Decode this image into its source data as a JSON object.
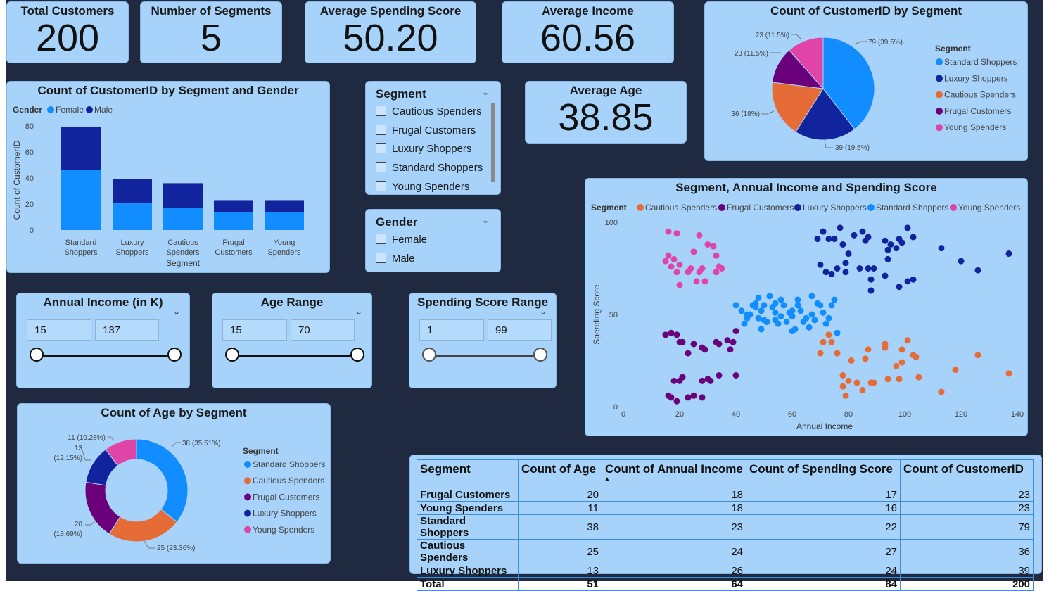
{
  "kpis": {
    "total_customers": {
      "title": "Total Customers",
      "value": "200"
    },
    "num_segments": {
      "title": "Number of Segments",
      "value": "5"
    },
    "avg_spending": {
      "title": "Average Spending Score",
      "value": "50.20"
    },
    "avg_income": {
      "title": "Average Income",
      "value": "60.56"
    },
    "avg_age": {
      "title": "Average Age",
      "value": "38.85"
    }
  },
  "colors": {
    "standard": "#118dff",
    "luxury": "#12239e",
    "cautious": "#e66c37",
    "frugal": "#6b007b",
    "young": "#e044a7",
    "female": "#118dff",
    "male": "#12239e"
  },
  "bar_chart": {
    "title": "Count of CustomerID by Segment and Gender",
    "legend_title": "Gender",
    "legend": [
      "Female",
      "Male"
    ],
    "ylabel": "Count of CustomerID",
    "xlabel": "Segment",
    "yticks": [
      "0",
      "20",
      "40",
      "60",
      "80"
    ],
    "categories": [
      [
        "Standard",
        "Shoppers"
      ],
      [
        "Luxury",
        "Shoppers"
      ],
      [
        "Cautious",
        "Spenders"
      ],
      [
        "Frugal",
        "Customers"
      ],
      [
        "Young",
        "Spenders"
      ]
    ]
  },
  "pie_chart": {
    "title": "Count of CustomerID by Segment",
    "legend_title": "Segment",
    "legend": [
      "Standard Shoppers",
      "Luxury Shoppers",
      "Cautious Spenders",
      "Frugal Customers",
      "Young Spenders"
    ],
    "labels": [
      "79 (39.5%)",
      "39 (19.5%)",
      "36 (18%)",
      "23 (11.5%)",
      "23 (11.5%)"
    ]
  },
  "segment_slicer": {
    "title": "Segment",
    "items": [
      "Cautious Spenders",
      "Frugal Customers",
      "Luxury Shoppers",
      "Standard Shoppers",
      "Young Spenders"
    ]
  },
  "gender_slicer": {
    "title": "Gender",
    "items": [
      "Female",
      "Male"
    ]
  },
  "income_range": {
    "title": "Annual Income (in K)",
    "min": "15",
    "max": "137"
  },
  "age_range": {
    "title": "Age Range",
    "min": "15",
    "max": "70"
  },
  "spending_range": {
    "title": "Spending Score Range",
    "min": "1",
    "max": "99"
  },
  "scatter": {
    "title": "Segment, Annual Income and Spending Score",
    "legend_title": "Segment",
    "legend": [
      "Cautious Spenders",
      "Frugal Customers",
      "Luxury Shoppers",
      "Standard Shoppers",
      "Young Spenders"
    ],
    "xlabel": "Annual Income",
    "ylabel": "Spending Score",
    "xticks": [
      "0",
      "20",
      "40",
      "60",
      "80",
      "100",
      "120",
      "140"
    ],
    "yticks": [
      "0",
      "50",
      "100"
    ]
  },
  "donut": {
    "title": "Count of Age by Segment",
    "legend_title": "Segment",
    "legend": [
      "Standard Shoppers",
      "Cautious Spenders",
      "Frugal Customers",
      "Luxury Shoppers",
      "Young Spenders"
    ],
    "labels": [
      "38 (35.51%)",
      "25 (23.36%)",
      "20",
      "(18.69%)",
      "13",
      "(12.15%)",
      "11 (10.28%)"
    ]
  },
  "table": {
    "headers": [
      "Segment",
      "Count of Age",
      "Count of Annual Income",
      "Count of Spending Score",
      "Count of CustomerID"
    ],
    "rows": [
      [
        "Frugal Customers",
        "20",
        "18",
        "17",
        "23"
      ],
      [
        "Young Spenders",
        "11",
        "18",
        "16",
        "23"
      ],
      [
        "Standard Shoppers",
        "38",
        "23",
        "22",
        "79"
      ],
      [
        "Cautious Spenders",
        "25",
        "24",
        "27",
        "36"
      ],
      [
        "Luxury Shoppers",
        "13",
        "26",
        "24",
        "39"
      ]
    ],
    "total": [
      "Total",
      "51",
      "64",
      "84",
      "200"
    ]
  },
  "chart_data": [
    {
      "type": "bar",
      "title": "Count of CustomerID by Segment and Gender",
      "categories": [
        "Standard Shoppers",
        "Luxury Shoppers",
        "Cautious Spenders",
        "Frugal Customers",
        "Young Spenders"
      ],
      "series": [
        {
          "name": "Female",
          "values": [
            46,
            21,
            17,
            14,
            14
          ]
        },
        {
          "name": "Male",
          "values": [
            33,
            18,
            19,
            9,
            9
          ]
        }
      ],
      "stacked": true,
      "xlabel": "Segment",
      "ylabel": "Count of CustomerID",
      "ylim": [
        0,
        80
      ]
    },
    {
      "type": "pie",
      "title": "Count of CustomerID by Segment",
      "categories": [
        "Standard Shoppers",
        "Luxury Shoppers",
        "Cautious Spenders",
        "Frugal Customers",
        "Young Spenders"
      ],
      "values": [
        79,
        39,
        36,
        23,
        23
      ]
    },
    {
      "type": "pie",
      "title": "Count of Age by Segment",
      "donut": true,
      "categories": [
        "Standard Shoppers",
        "Cautious Spenders",
        "Frugal Customers",
        "Luxury Shoppers",
        "Young Spenders"
      ],
      "values": [
        38,
        25,
        20,
        13,
        11
      ]
    },
    {
      "type": "scatter",
      "title": "Segment, Annual Income and Spending Score",
      "xlabel": "Annual Income",
      "ylabel": "Spending Score",
      "xlim": [
        0,
        140
      ],
      "ylim": [
        0,
        100
      ],
      "series": [
        {
          "name": "Young Spenders",
          "points": [
            [
              16,
              95
            ],
            [
              19,
              94
            ],
            [
              16,
              82
            ],
            [
              15,
              79
            ],
            [
              17,
              76
            ],
            [
              18,
              80
            ],
            [
              20,
              77
            ],
            [
              19,
              73
            ],
            [
              23,
              73
            ],
            [
              24,
              75
            ],
            [
              26,
              68
            ],
            [
              27,
              73
            ],
            [
              28,
              75
            ],
            [
              25,
              84
            ],
            [
              27,
              93
            ],
            [
              30,
              88
            ],
            [
              32,
              87
            ],
            [
              33,
              82
            ],
            [
              33,
              73
            ],
            [
              34,
              76
            ],
            [
              35,
              75
            ],
            [
              29,
              68
            ],
            [
              20,
              66
            ]
          ]
        },
        {
          "name": "Frugal Customers",
          "points": [
            [
              15,
              39
            ],
            [
              17,
              40
            ],
            [
              19,
              39
            ],
            [
              20,
              35
            ],
            [
              21,
              35
            ],
            [
              23,
              29
            ],
            [
              25,
              34
            ],
            [
              28,
              32
            ],
            [
              28,
              14
            ],
            [
              29,
              31
            ],
            [
              33,
              35
            ],
            [
              34,
              34
            ],
            [
              37,
              36
            ],
            [
              38,
              31
            ],
            [
              39,
              35
            ],
            [
              40,
              41
            ],
            [
              16,
              6
            ],
            [
              17,
              5
            ],
            [
              18,
              14
            ],
            [
              19,
              3
            ],
            [
              20,
              14
            ],
            [
              21,
              16
            ],
            [
              23,
              5
            ],
            [
              25,
              6
            ],
            [
              28,
              5
            ],
            [
              30,
              15
            ],
            [
              31,
              14
            ],
            [
              34,
              17
            ],
            [
              40,
              17
            ]
          ]
        },
        {
          "name": "Standard Shoppers",
          "points": [
            [
              40,
              55
            ],
            [
              42,
              52
            ],
            [
              43,
              45
            ],
            [
              44,
              48
            ],
            [
              45,
              50
            ],
            [
              46,
              55
            ],
            [
              47,
              56
            ],
            [
              48,
              48
            ],
            [
              48,
              59
            ],
            [
              49,
              42
            ],
            [
              50,
              47
            ],
            [
              50,
              55
            ],
            [
              51,
              46
            ],
            [
              52,
              60
            ],
            [
              53,
              54
            ],
            [
              54,
              47
            ],
            [
              54,
              51
            ],
            [
              54,
              56
            ],
            [
              55,
              45
            ],
            [
              56,
              49
            ],
            [
              57,
              55
            ],
            [
              58,
              46
            ],
            [
              59,
              51
            ],
            [
              60,
              52
            ],
            [
              60,
              49
            ],
            [
              61,
              42
            ],
            [
              62,
              55
            ],
            [
              62,
              58
            ],
            [
              63,
              52
            ],
            [
              64,
              46
            ],
            [
              65,
              48
            ],
            [
              66,
              43
            ],
            [
              67,
              50
            ],
            [
              68,
              47
            ],
            [
              69,
              56
            ],
            [
              70,
              55
            ],
            [
              71,
              51
            ],
            [
              72,
              45
            ],
            [
              73,
              48
            ],
            [
              74,
              55
            ],
            [
              75,
              58
            ],
            [
              76,
              40
            ],
            [
              67,
              60
            ],
            [
              60,
              41
            ],
            [
              56,
              58
            ],
            [
              44,
              50
            ],
            [
              47,
              54
            ],
            [
              49,
              52
            ]
          ]
        },
        {
          "name": "Cautious Spenders",
          "points": [
            [
              70,
              29
            ],
            [
              71,
              35
            ],
            [
              73,
              39
            ],
            [
              74,
              35
            ],
            [
              76,
              29
            ],
            [
              78,
              17
            ],
            [
              78,
              11
            ],
            [
              80,
              14
            ],
            [
              79,
              6
            ],
            [
              81,
              25
            ],
            [
              83,
              13
            ],
            [
              85,
              9
            ],
            [
              86,
              26
            ],
            [
              87,
              31
            ],
            [
              88,
              13
            ],
            [
              89,
              13
            ],
            [
              93,
              34
            ],
            [
              93,
              32
            ],
            [
              94,
              15
            ],
            [
              97,
              22
            ],
            [
              98,
              15
            ],
            [
              99,
              31
            ],
            [
              99,
              24
            ],
            [
              101,
              36
            ],
            [
              103,
              28
            ],
            [
              104,
              27
            ],
            [
              105,
              16
            ],
            [
              113,
              8
            ],
            [
              118,
              20
            ],
            [
              126,
              28
            ],
            [
              137,
              18
            ]
          ]
        },
        {
          "name": "Luxury Shoppers",
          "points": [
            [
              69,
              91
            ],
            [
              70,
              77
            ],
            [
              71,
              95
            ],
            [
              72,
              73
            ],
            [
              73,
              91
            ],
            [
              74,
              72
            ],
            [
              75,
              91
            ],
            [
              76,
              75
            ],
            [
              77,
              97
            ],
            [
              78,
              88
            ],
            [
              79,
              73
            ],
            [
              80,
              83
            ],
            [
              82,
              93
            ],
            [
              84,
              75
            ],
            [
              85,
              95
            ],
            [
              86,
              90
            ],
            [
              87,
              75
            ],
            [
              87,
              92
            ],
            [
              88,
              63
            ],
            [
              88,
              69
            ],
            [
              89,
              75
            ],
            [
              93,
              90
            ],
            [
              94,
              80
            ],
            [
              95,
              88
            ],
            [
              97,
              86
            ],
            [
              98,
              91
            ],
            [
              99,
              89
            ],
            [
              101,
              97
            ],
            [
              103,
              92
            ],
            [
              113,
              86
            ],
            [
              120,
              79
            ],
            [
              126,
              74
            ],
            [
              137,
              83
            ],
            [
              93,
              71
            ],
            [
              94,
              85
            ],
            [
              98,
              65
            ],
            [
              101,
              68
            ],
            [
              103,
              69
            ],
            [
              79,
              78
            ]
          ]
        }
      ]
    }
  ]
}
